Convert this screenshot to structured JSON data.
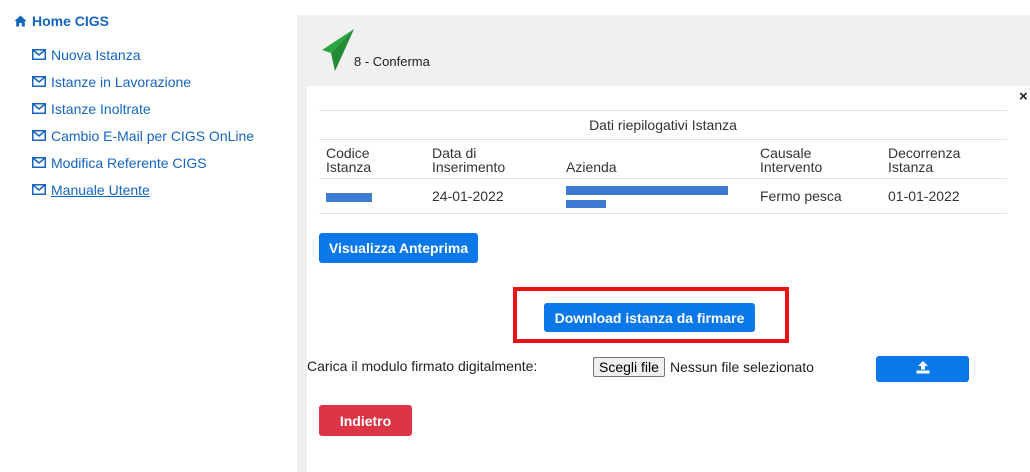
{
  "sidebar": {
    "home_label": "Home CIGS",
    "items": [
      {
        "label": "Nuova Istanza"
      },
      {
        "label": "Istanze in Lavorazione"
      },
      {
        "label": "Istanze Inoltrate"
      },
      {
        "label": "Cambio E-Mail per CIGS OnLine"
      },
      {
        "label": "Modifica Referente CIGS"
      },
      {
        "label": "Manuale Utente"
      }
    ]
  },
  "header": {
    "step_label": "8 - Conferma",
    "close_symbol": "×",
    "accent_color": "#2aa640"
  },
  "summary": {
    "caption": "Dati riepilogativi Istanza",
    "columns": [
      {
        "line1": "Codice",
        "line2": "Istanza"
      },
      {
        "line1": "Data di",
        "line2": "Inserimento"
      },
      {
        "line1": "",
        "line2": "Azienda"
      },
      {
        "line1": "Causale",
        "line2": "Intervento"
      },
      {
        "line1": "Decorrenza",
        "line2": "Istanza"
      }
    ],
    "row": {
      "codice": "",
      "data_inserimento": "24-01-2022",
      "azienda": "",
      "causale": "Fermo pesca",
      "decorrenza": "01-01-2022"
    }
  },
  "actions": {
    "preview_label": "Visualizza Anteprima",
    "download_label": "Download istanza da firmare",
    "upload_label": "Carica il modulo firmato digitalmente:",
    "file_button_label": "Scegli file",
    "file_status": "Nessun file selezionato",
    "back_label": "Indietro"
  },
  "colors": {
    "primary": "#0a78e8",
    "danger": "#dc3545",
    "highlight": "#ee1111",
    "link": "#1565c0"
  }
}
